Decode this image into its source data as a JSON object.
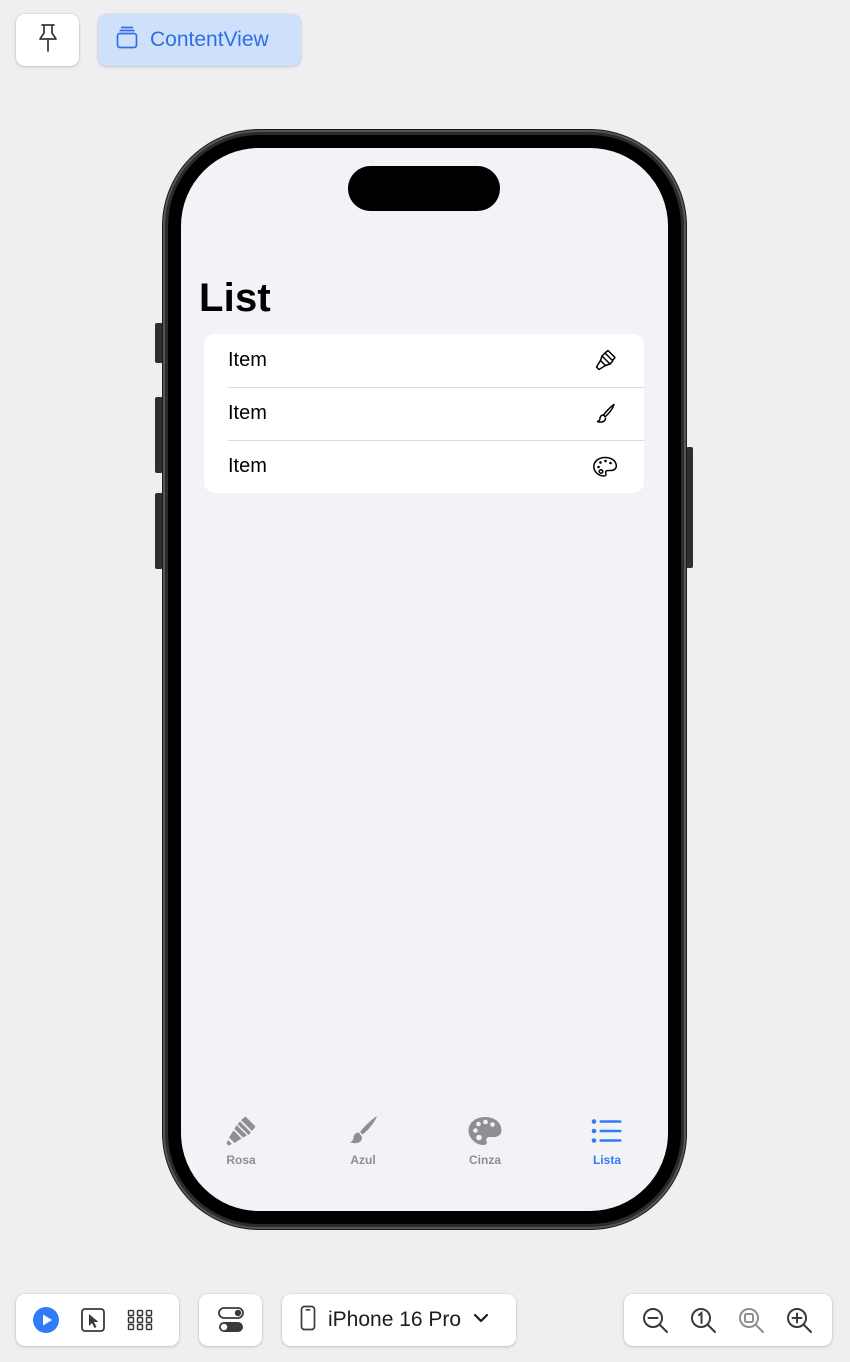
{
  "toolbar": {
    "pin_icon": "pin-icon",
    "canvas_button_label": "ContentView",
    "canvas_icon": "stacked-window-icon"
  },
  "screen": {
    "title": "List",
    "list_items": [
      {
        "label": "Item",
        "icon": "paintbrush-pointed-icon"
      },
      {
        "label": "Item",
        "icon": "paintbrush-icon"
      },
      {
        "label": "Item",
        "icon": "paintpalette-icon"
      }
    ],
    "tabs": [
      {
        "label": "Rosa",
        "icon": "paintbrush-pointed-fill-icon",
        "active": false
      },
      {
        "label": "Azul",
        "icon": "paintbrush-fill-icon",
        "active": false
      },
      {
        "label": "Cinza",
        "icon": "paintpalette-fill-icon",
        "active": false
      },
      {
        "label": "Lista",
        "icon": "list-bullet-icon",
        "active": true
      }
    ]
  },
  "bottom_bar": {
    "modes": [
      "live-play-icon",
      "selectable-pointer-icon",
      "variants-grid-icon"
    ],
    "settings_icon": "device-settings-toggle-icon",
    "device_name": "iPhone 16 Pro",
    "zoom": [
      "zoom-out-icon",
      "zoom-actual-size-icon",
      "zoom-to-fit-icon",
      "zoom-in-icon"
    ]
  },
  "colors": {
    "accent": "#2f7cf6",
    "inactive_tab": "#8e8e93",
    "screen_background": "#f2f2f7",
    "selected_toolbar_button": "#cfe0fb"
  }
}
